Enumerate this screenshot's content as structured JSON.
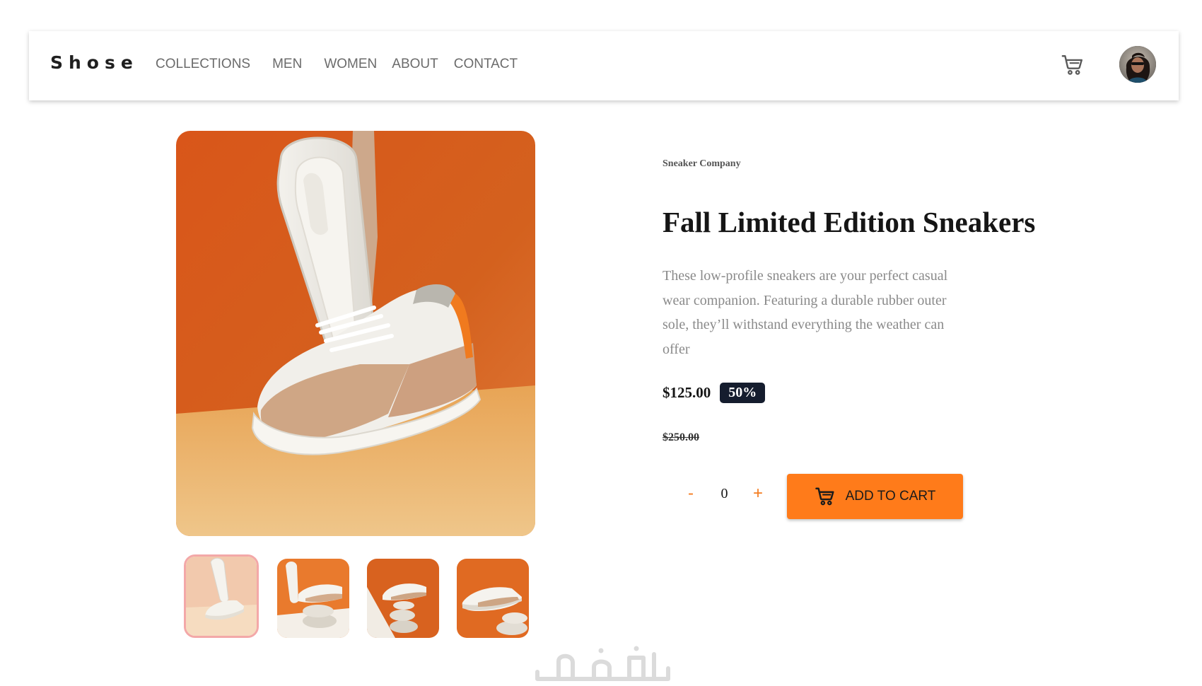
{
  "header": {
    "logo": "Shose",
    "nav": [
      "COLLECTIONS",
      "MEN",
      "WOMEN",
      "ABOUT",
      "CONTACT"
    ],
    "cart_icon": "cart-icon",
    "avatar_icon": "user-avatar"
  },
  "gallery": {
    "main_image": "sneaker-main-photo",
    "thumbnails": [
      "thumbnail-1",
      "thumbnail-2",
      "thumbnail-3",
      "thumbnail-4"
    ],
    "selected_thumbnail": 1
  },
  "product": {
    "company": "Sneaker Company",
    "title": "Fall Limited Edition Sneakers",
    "description": "These low-profile sneakers are your perfect casual wear companion. Featuring a durable rubber outer sole, they’ll withstand everything the weather can offer",
    "price": "$125.00",
    "discount": "50%",
    "old_price": "$250.00"
  },
  "quantity": {
    "minus": "-",
    "value": "0",
    "plus": "+"
  },
  "add_to_cart": {
    "label": "ADD TO CART",
    "icon": "cart-icon"
  },
  "colors": {
    "accent": "#ff7b1a",
    "dark": "#151d2e",
    "text_muted": "#8a8a8a"
  },
  "watermark": "خمسات"
}
